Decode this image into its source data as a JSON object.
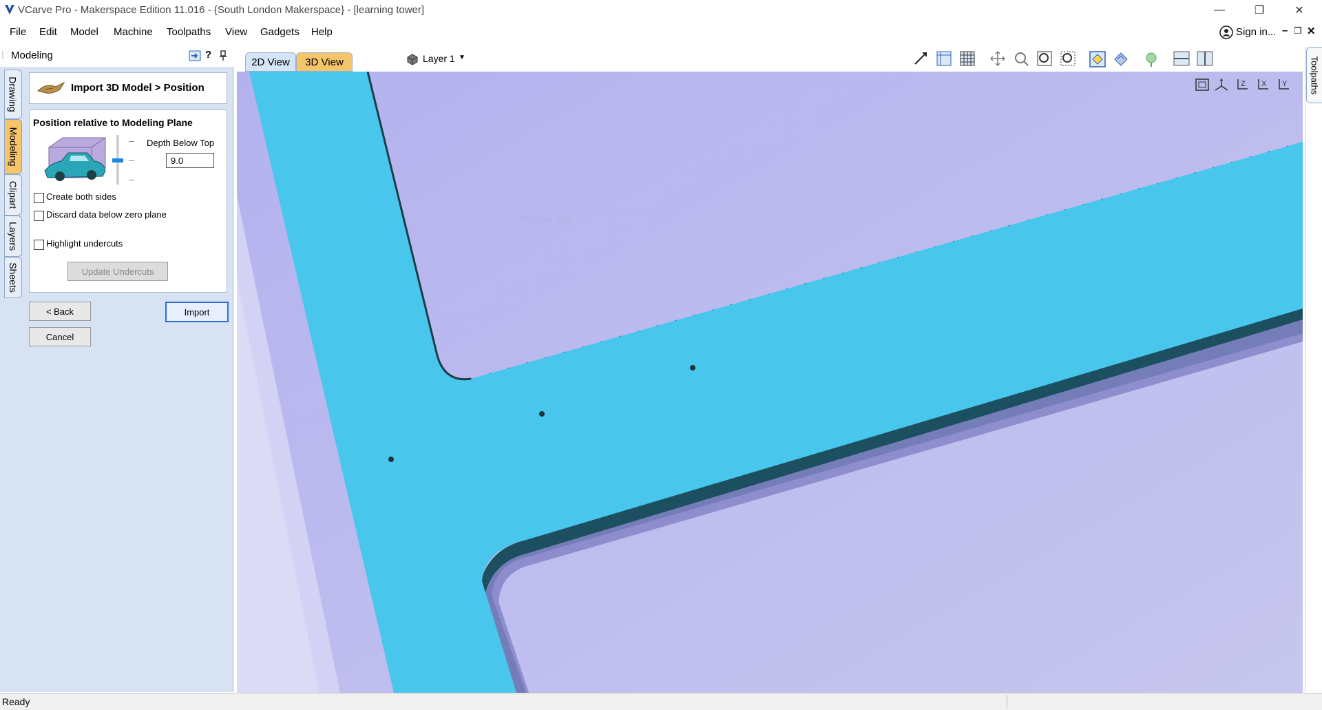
{
  "window": {
    "title": "VCarve Pro - Makerspace Edition 11.016 - {South London Makerspace} - [learning tower]",
    "minimize_glyph": "—",
    "restore_glyph": "❐",
    "close_glyph": "✕"
  },
  "menu": {
    "items": [
      "File",
      "Edit",
      "Model",
      "Machine",
      "Toolpaths",
      "View",
      "Gadgets",
      "Help"
    ],
    "sign_in": "Sign in...",
    "min_glyph": "–",
    "restore_glyph": "❐",
    "close_glyph": "✕"
  },
  "left_panel": {
    "title": "Modeling",
    "help": "?",
    "pin": "📌",
    "tabs": [
      "Drawing",
      "Modeling",
      "Clipart",
      "Layers",
      "Sheets"
    ]
  },
  "dialog": {
    "header": "Import 3D Model > Position",
    "section_title": "Position relative to Modeling Plane",
    "depth_label": "Depth Below Top",
    "depth_value": "9.0",
    "create_both_sides": "Create both sides",
    "discard_data": "Discard data below zero plane",
    "highlight_undercuts": "Highlight undercuts",
    "update_undercuts": "Update Undercuts",
    "back": "< Back",
    "import": "Import",
    "cancel": "Cancel"
  },
  "view": {
    "tab_2d": "2D View",
    "tab_3d": "3D View",
    "layer": "Layer 1",
    "right_tab": "Toolpaths",
    "watermark": "Window Snip"
  },
  "status": {
    "text": "Ready"
  },
  "colors": {
    "panel_bg": "#d7e3f2",
    "viewport_bg": "#c3c3ec",
    "model_fill": "#48c6ec",
    "active_tab": "#f4c56a"
  }
}
